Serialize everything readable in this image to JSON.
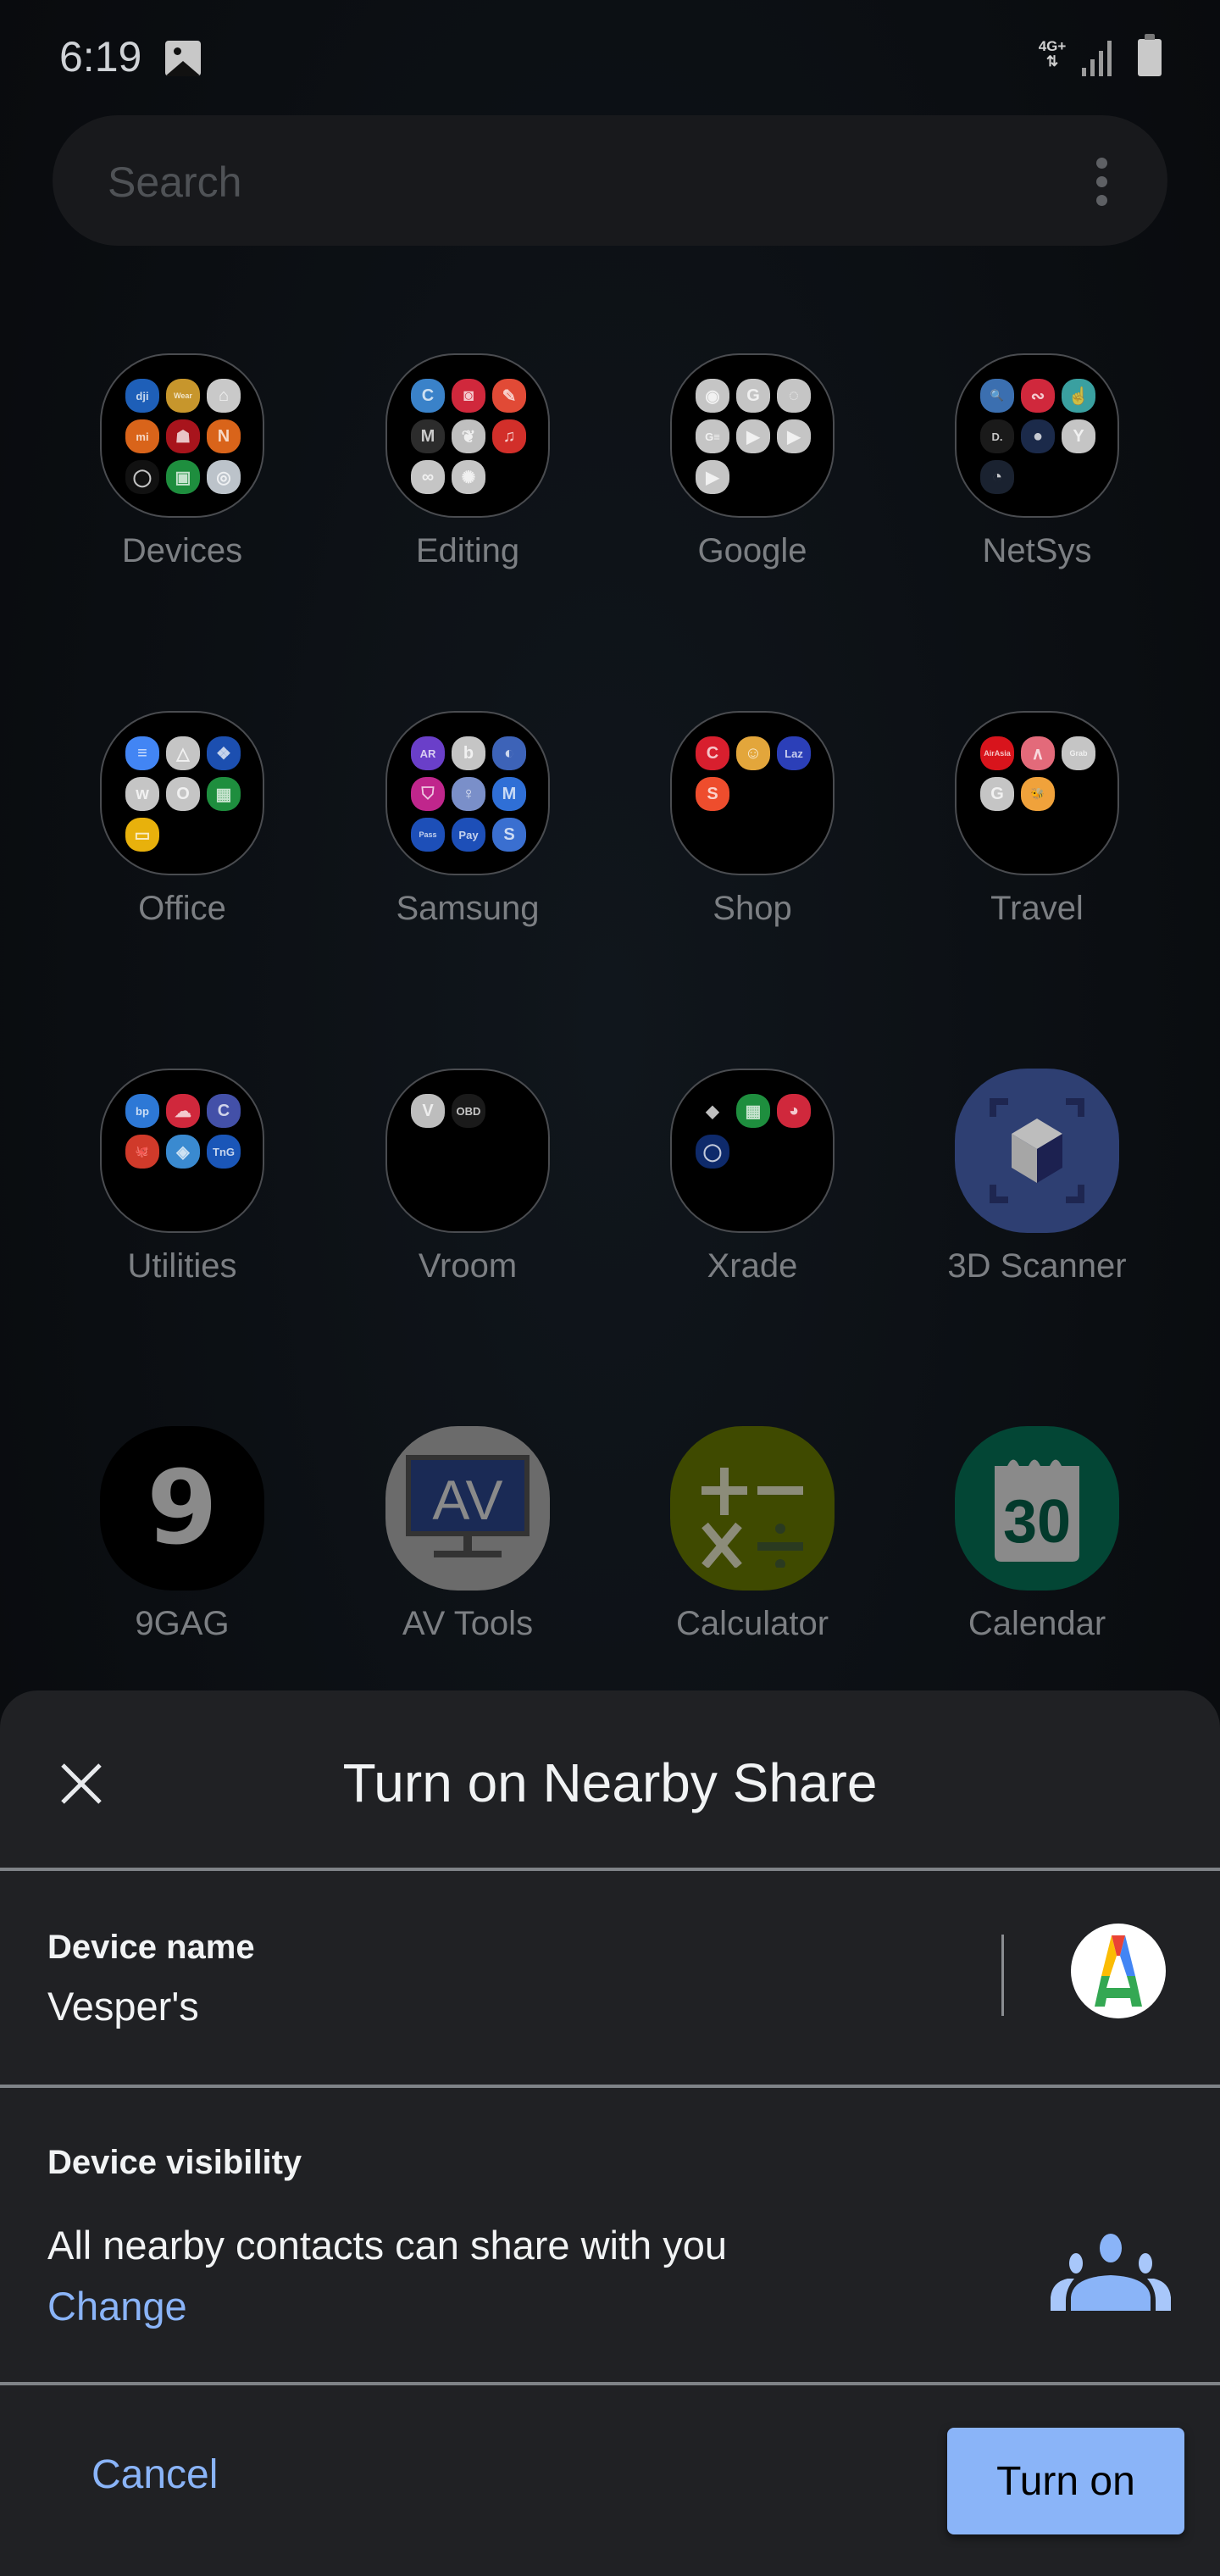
{
  "status_bar": {
    "time": "6:19",
    "network_type": "4G+",
    "icons": [
      "gallery-icon",
      "data-arrows-icon",
      "signal-icon",
      "battery-icon"
    ]
  },
  "search": {
    "placeholder": "Search",
    "menu_icon": "more-vert-icon"
  },
  "apps": [
    {
      "label": "Devices",
      "type": "folder",
      "apps": [
        {
          "t": "dji",
          "c": "#1e5fb8"
        },
        {
          "t": "Wear",
          "c": "#c7962c"
        },
        {
          "t": "⌂",
          "c": "#c9c9c9"
        },
        {
          "t": "mi",
          "c": "#d9641a"
        },
        {
          "t": "☗",
          "c": "#a8141c"
        },
        {
          "t": "N",
          "c": "#d9641a"
        },
        {
          "t": "◯",
          "c": "#111111"
        },
        {
          "t": "▣",
          "c": "#1e8e3e"
        },
        {
          "t": "◎",
          "c": "#bcc3ca"
        }
      ]
    },
    {
      "label": "Editing",
      "type": "folder",
      "apps": [
        {
          "t": "C",
          "c": "#3a82c9"
        },
        {
          "t": "◙",
          "c": "#d0283c"
        },
        {
          "t": "✎",
          "c": "#e14a36"
        },
        {
          "t": "M",
          "c": "#2c2c2c"
        },
        {
          "t": "❦",
          "c": "#bfbfbf"
        },
        {
          "t": "♫",
          "c": "#d22f2a"
        },
        {
          "t": "∞",
          "c": "#c5c5c5"
        },
        {
          "t": "✺",
          "c": "#c5c5c5"
        }
      ]
    },
    {
      "label": "Google",
      "type": "folder",
      "apps": [
        {
          "t": "◉",
          "c": "#c5c5c5"
        },
        {
          "t": "G",
          "c": "#c5c5c5"
        },
        {
          "t": "◌",
          "c": "#c5c5c5"
        },
        {
          "t": "G≡",
          "c": "#c5c5c5"
        },
        {
          "t": "▶",
          "c": "#c5c5c5"
        },
        {
          "t": "▶",
          "c": "#c5c5c5"
        },
        {
          "t": "▶",
          "c": "#c5c5c5"
        }
      ]
    },
    {
      "label": "NetSys",
      "type": "folder",
      "apps": [
        {
          "t": "🔍",
          "c": "#3b6fb0"
        },
        {
          "t": "∾",
          "c": "#d0283c"
        },
        {
          "t": "☝",
          "c": "#3aa0a0"
        },
        {
          "t": "D.",
          "c": "#1a1a1a"
        },
        {
          "t": "●",
          "c": "#1b2a4a"
        },
        {
          "t": "Y",
          "c": "#c5c5c5"
        },
        {
          "t": "◔",
          "c": "#1a2230"
        }
      ]
    },
    {
      "label": "Office",
      "type": "folder",
      "apps": [
        {
          "t": "≡",
          "c": "#4285f4"
        },
        {
          "t": "△",
          "c": "#c5c5c5"
        },
        {
          "t": "❖",
          "c": "#1c4fb0"
        },
        {
          "t": "w",
          "c": "#c5c5c5"
        },
        {
          "t": "O",
          "c": "#c5c5c5"
        },
        {
          "t": "▦",
          "c": "#1e8e3e"
        },
        {
          "t": "▭",
          "c": "#e8b10c"
        }
      ]
    },
    {
      "label": "Samsung",
      "type": "folder",
      "apps": [
        {
          "t": "AR",
          "c": "#6a3fc9"
        },
        {
          "t": "b",
          "c": "#c5c5c5"
        },
        {
          "t": "◐",
          "c": "#3d63b8"
        },
        {
          "t": "⛉",
          "c": "#c0268c"
        },
        {
          "t": "♀",
          "c": "#7a8fc9"
        },
        {
          "t": "M",
          "c": "#2f6fd6"
        },
        {
          "t": "Pass",
          "c": "#1d4fb8"
        },
        {
          "t": "Pay",
          "c": "#1d4fb8"
        },
        {
          "t": "S",
          "c": "#3a6fd0"
        }
      ]
    },
    {
      "label": "Shop",
      "type": "folder",
      "apps": [
        {
          "t": "C",
          "c": "#d81f2e"
        },
        {
          "t": "☺",
          "c": "#e3a63b"
        },
        {
          "t": "Laz",
          "c": "#2b3fb8"
        },
        {
          "t": "S",
          "c": "#ee4d2d"
        }
      ]
    },
    {
      "label": "Travel",
      "type": "folder",
      "apps": [
        {
          "t": "AirAsia",
          "c": "#d8141c"
        },
        {
          "t": "∧",
          "c": "#e36a7a"
        },
        {
          "t": "Grab",
          "c": "#c5c5c5"
        },
        {
          "t": "G",
          "c": "#c5c5c5"
        },
        {
          "t": "🐝",
          "c": "#f0a23b"
        }
      ]
    },
    {
      "label": "Utilities",
      "type": "folder",
      "apps": [
        {
          "t": "bp",
          "c": "#2d78d6"
        },
        {
          "t": "☁",
          "c": "#d0283c"
        },
        {
          "t": "C",
          "c": "#4350a8"
        },
        {
          "t": "🐙",
          "c": "#d03a2a"
        },
        {
          "t": "◈",
          "c": "#3a8ad0"
        },
        {
          "t": "TnG",
          "c": "#1a56b8"
        }
      ]
    },
    {
      "label": "Vroom",
      "type": "folder",
      "apps": [
        {
          "t": "V",
          "c": "#bdbdbd"
        },
        {
          "t": "OBD",
          "c": "#1a1a1a"
        }
      ]
    },
    {
      "label": "Xrade",
      "type": "folder",
      "apps": [
        {
          "t": "◆",
          "c": "#000000"
        },
        {
          "t": "▦",
          "c": "#1e8e3e"
        },
        {
          "t": "◕",
          "c": "#d0283c"
        },
        {
          "t": "◯",
          "c": "#0e2a6b"
        }
      ]
    },
    {
      "label": "3D Scanner",
      "type": "app",
      "icon": "3d-scanner-icon",
      "bg": "#2e3f72"
    },
    {
      "label": "9GAG",
      "type": "app",
      "icon": "9gag-icon",
      "bg": "#000000"
    },
    {
      "label": "AV Tools",
      "type": "app",
      "icon": "av-tools-icon",
      "bg": "#6b6b6b"
    },
    {
      "label": "Calculator",
      "type": "app",
      "icon": "calculator-icon",
      "bg": "#3f4a00"
    },
    {
      "label": "Calendar",
      "type": "app",
      "icon": "calendar-icon",
      "bg": "#034635"
    }
  ],
  "app_icon_text": {
    "av": "AV",
    "calendar_day": "30",
    "nine": "9"
  },
  "sheet": {
    "title": "Turn on Nearby Share",
    "device_name_label": "Device name",
    "device_name_value": "Vesper's",
    "visibility_label": "Device visibility",
    "visibility_value": "All nearby contacts can share with you",
    "change_link": "Change",
    "cancel_label": "Cancel",
    "turn_on_label": "Turn on",
    "accent_color": "#8ab4f8",
    "avatar_letter": "A"
  }
}
